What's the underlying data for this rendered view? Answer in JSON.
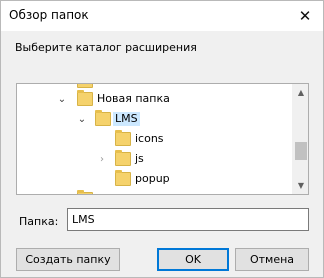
{
  "window": {
    "title": "Обзор папок",
    "close_glyph": "✕"
  },
  "prompt": "Выберите каталог расширения",
  "tree": {
    "items": [
      {
        "label": "Новая папка",
        "expander": "chevron-down",
        "glyph": "⌄",
        "selected": false
      },
      {
        "label": "LMS",
        "expander": "chevron-down",
        "glyph": "⌄",
        "selected": true
      },
      {
        "label": "icons",
        "expander": "none",
        "glyph": "",
        "selected": false
      },
      {
        "label": "js",
        "expander": "chevron-right",
        "glyph": "›",
        "selected": false
      },
      {
        "label": "popup",
        "expander": "none",
        "glyph": "",
        "selected": false
      }
    ],
    "folder_color": "#f5d26c",
    "selection_color": "#cce8ff"
  },
  "scrollbar": {
    "up_glyph": "▲",
    "down_glyph": "▼"
  },
  "folder_field": {
    "label": "Папка:",
    "value": "LMS"
  },
  "buttons": {
    "new_folder": "Создать папку",
    "ok": "OK",
    "cancel": "Отмена"
  },
  "colors": {
    "accent": "#0078d7"
  }
}
